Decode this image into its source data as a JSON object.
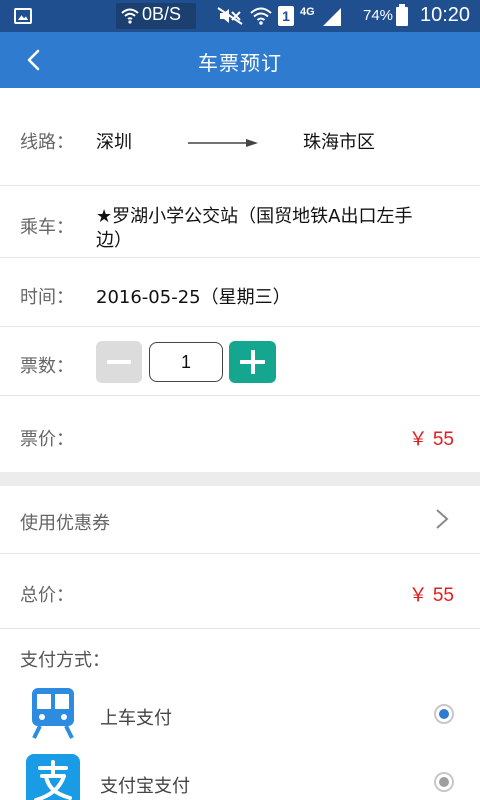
{
  "status_bar": {
    "speed": "0B/S",
    "sim_label": "1",
    "network_label": "4G",
    "battery_pct": "74%",
    "time": "10:20"
  },
  "header": {
    "title": "车票预订",
    "back_icon": "chevron-left-icon"
  },
  "route": {
    "label": "线路：",
    "from": "深圳",
    "to": "珠海市区"
  },
  "boarding": {
    "label": "乘车：",
    "station_line1": "★罗湖小学公交站（国贸地铁A出口左手",
    "station_line2": "边）"
  },
  "time": {
    "label": "时间：",
    "value": "2016-05-25（星期三）"
  },
  "tickets": {
    "label": "票数：",
    "quantity": "1"
  },
  "fare": {
    "label": "票价：",
    "value": "￥ 55"
  },
  "coupon": {
    "label": "使用优惠券"
  },
  "total": {
    "label": "总价：",
    "value": "￥ 55"
  },
  "payment": {
    "label": "支付方式：",
    "options": [
      {
        "label": "上车支付",
        "icon": "bus-icon",
        "selected": true
      },
      {
        "label": "支付宝支付",
        "icon": "alipay-icon",
        "selected": false
      }
    ]
  },
  "colors": {
    "status_bar": "#1f4f8f",
    "header": "#2e7bd0",
    "price": "#e02020",
    "plus_button": "#14a68f",
    "minus_button": "#dcdcdc",
    "radio_selected": "#2e7bd0",
    "radio_unselected": "#9e9e9e"
  }
}
